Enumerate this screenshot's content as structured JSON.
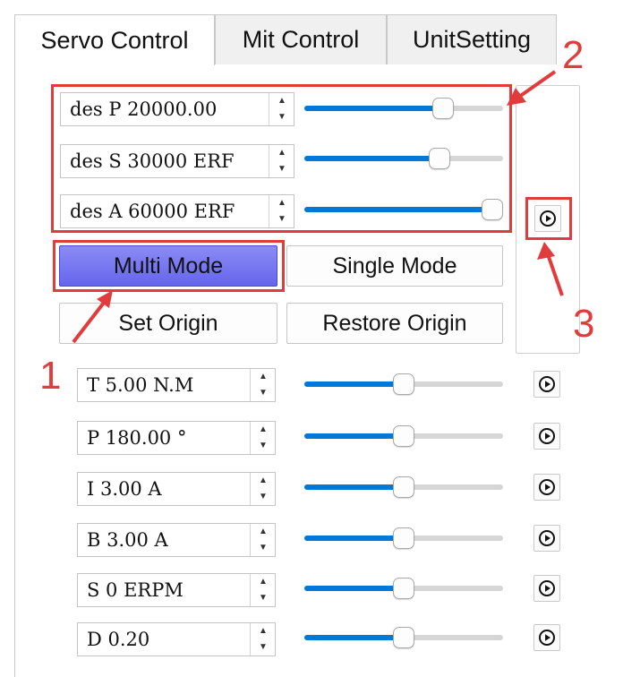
{
  "tabs": [
    {
      "label": "Servo Control",
      "active": true
    },
    {
      "label": "Mit Control",
      "active": false
    },
    {
      "label": "UnitSetting",
      "active": false
    }
  ],
  "servo": {
    "des_fields": [
      {
        "text": "des P 20000.00",
        "level_pct": 72
      },
      {
        "text": "des S 30000 ERF",
        "level_pct": 70
      },
      {
        "text": "des A 60000 ERF",
        "level_pct": 100
      }
    ],
    "multi_mode_label": "Multi Mode",
    "single_mode_label": "Single Mode",
    "set_origin_label": "Set Origin",
    "restore_origin_label": "Restore Origin"
  },
  "params": [
    {
      "text": "T 5.00 N.M",
      "level_pct": 50
    },
    {
      "text": "P 180.00 °",
      "level_pct": 50
    },
    {
      "text": "I 3.00 A",
      "level_pct": 50
    },
    {
      "text": "B 3.00 A",
      "level_pct": 50
    },
    {
      "text": "S 0 ERPM",
      "level_pct": 50
    },
    {
      "text": "D 0.20",
      "level_pct": 50
    }
  ],
  "annotations": {
    "one": "1",
    "two": "2",
    "three": "3"
  },
  "colors": {
    "accent": "#0078d7",
    "primary_button": "#7373f0",
    "annotation": "#e23b3b"
  },
  "icons": {
    "play": "play-circle-icon",
    "spin_up": "chevron-up-icon",
    "spin_down": "chevron-down-icon"
  }
}
